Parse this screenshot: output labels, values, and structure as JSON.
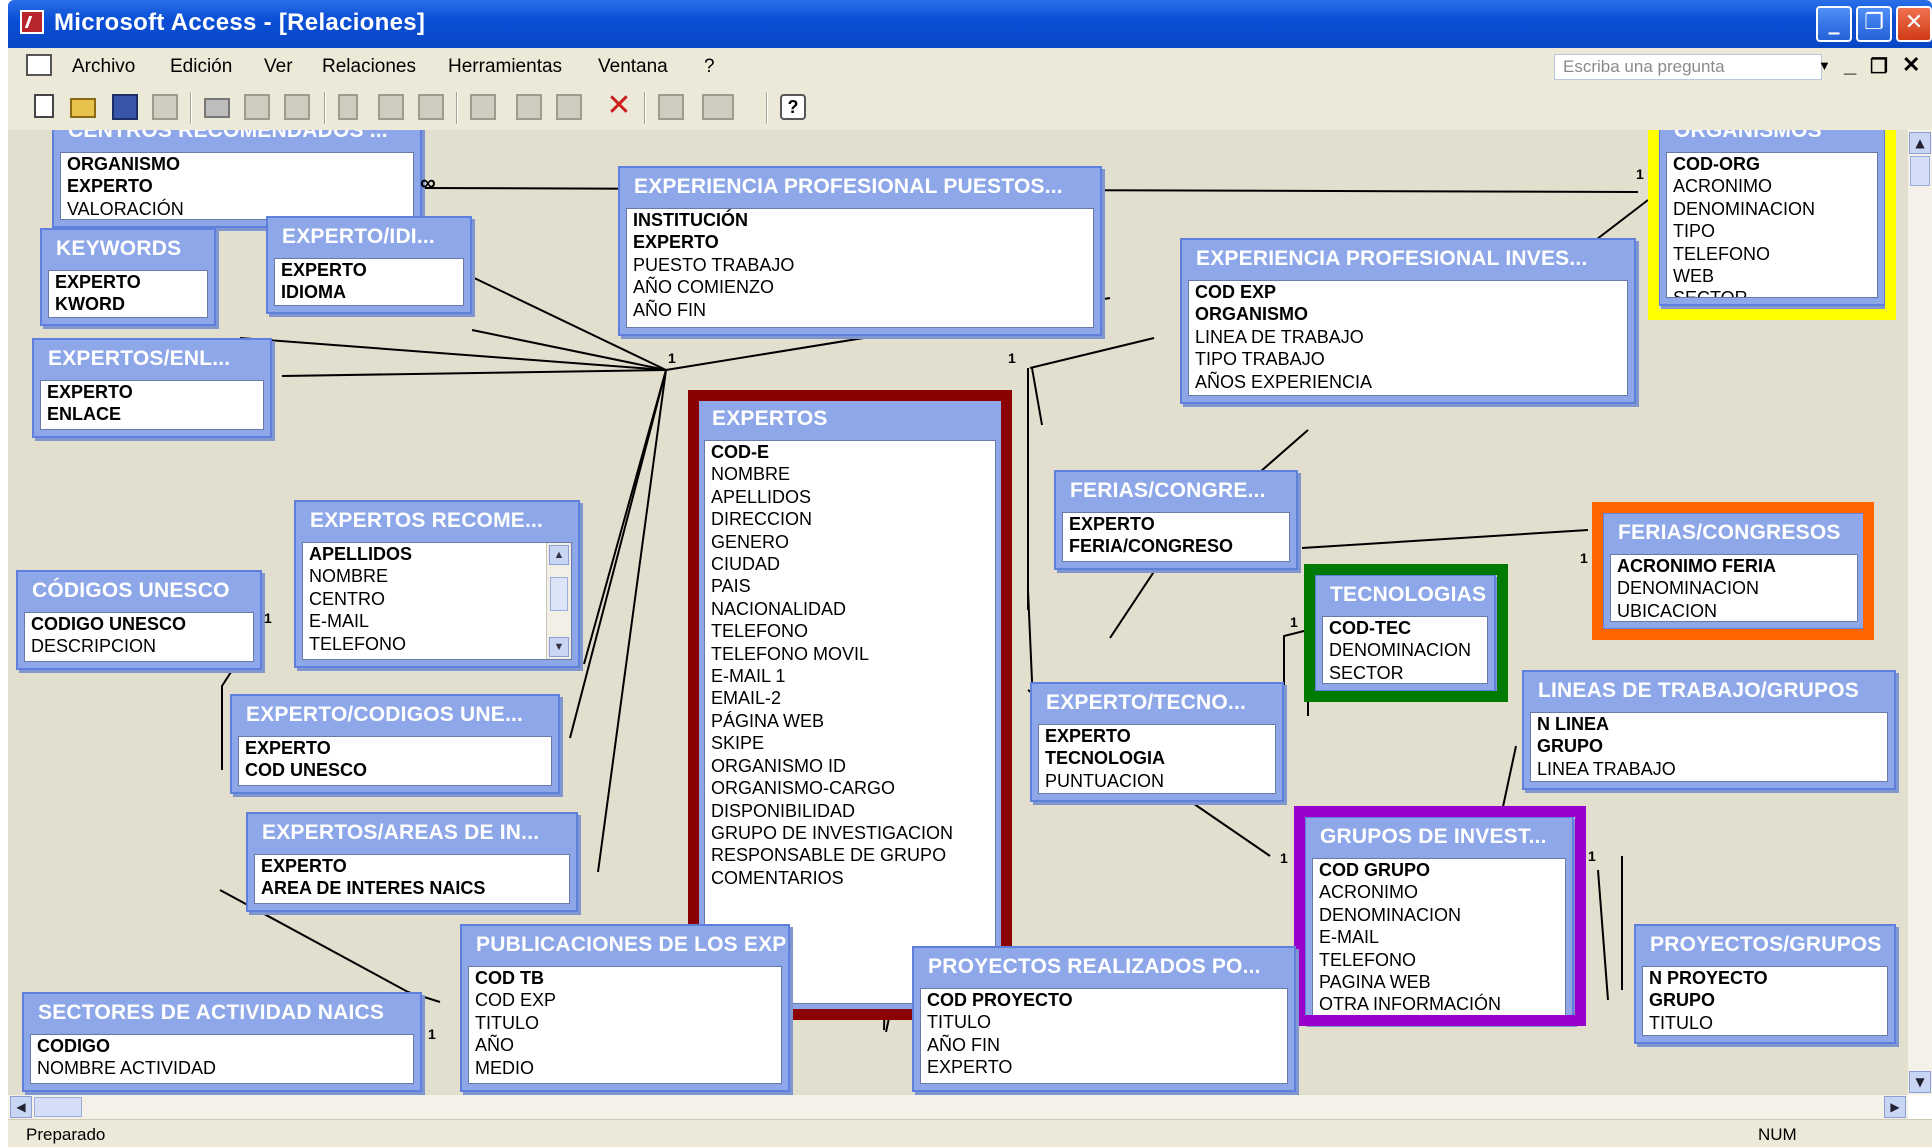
{
  "window": {
    "title": "Microsoft Access - [Relaciones]"
  },
  "menu": {
    "items": [
      "Archivo",
      "Edición",
      "Ver",
      "Relaciones",
      "Herramientas",
      "Ventana",
      "?"
    ],
    "ask_placeholder": "Escriba una pregunta"
  },
  "toolbar": {
    "icons": [
      "new-icon",
      "open-icon",
      "save-icon",
      "relationships-window-icon",
      "print-icon",
      "print-preview-icon",
      "spelling-icon",
      "cut-icon",
      "copy-icon",
      "paste-icon",
      "show-table-icon",
      "show-direct-icon",
      "show-all-icon",
      "delete-icon",
      "relationship-report-icon",
      "new-object-icon",
      "help-icon"
    ]
  },
  "tables": {
    "centros": {
      "title": "CENTROS RECOMENDADOS ...",
      "fields": [
        {
          "name": "ORGANISMO",
          "key": true
        },
        {
          "name": "EXPERTO",
          "key": true
        },
        {
          "name": "VALORACIÓN",
          "key": false
        }
      ]
    },
    "keywords": {
      "title": "KEYWORDS",
      "fields": [
        {
          "name": "EXPERTO",
          "key": true
        },
        {
          "name": "KWORD",
          "key": true
        }
      ]
    },
    "experto_idi": {
      "title": "EXPERTO/IDI...",
      "fields": [
        {
          "name": "EXPERTO",
          "key": true
        },
        {
          "name": "IDIOMA",
          "key": true
        }
      ]
    },
    "exp_puestos": {
      "title": "EXPERIENCIA PROFESIONAL PUESTOS...",
      "fields": [
        {
          "name": "INSTITUCIÓN",
          "key": true
        },
        {
          "name": "EXPERTO",
          "key": true
        },
        {
          "name": "PUESTO TRABAJO",
          "key": false
        },
        {
          "name": "AÑO COMIENZO",
          "key": false
        },
        {
          "name": "AÑO FIN",
          "key": false
        }
      ]
    },
    "organismos": {
      "title": "ORGANISMOS",
      "fields": [
        {
          "name": "COD-ORG",
          "key": true
        },
        {
          "name": "ACRONIMO",
          "key": false
        },
        {
          "name": "DENOMINACION",
          "key": false
        },
        {
          "name": "TIPO",
          "key": false
        },
        {
          "name": "TELEFONO",
          "key": false
        },
        {
          "name": "WEB",
          "key": false
        },
        {
          "name": "SECTOR",
          "key": false
        }
      ]
    },
    "exp_invest": {
      "title": "EXPERIENCIA PROFESIONAL INVES...",
      "fields": [
        {
          "name": "COD EXP",
          "key": true
        },
        {
          "name": "ORGANISMO",
          "key": true
        },
        {
          "name": "LINEA DE TRABAJO",
          "key": false
        },
        {
          "name": "TIPO TRABAJO",
          "key": false
        },
        {
          "name": "AÑOS EXPERIENCIA",
          "key": false
        }
      ]
    },
    "expertos_enl": {
      "title": "EXPERTOS/ENL...",
      "fields": [
        {
          "name": "EXPERTO",
          "key": true
        },
        {
          "name": "ENLACE",
          "key": true
        }
      ]
    },
    "expertos": {
      "title": "EXPERTOS",
      "fields": [
        {
          "name": "COD-E",
          "key": true
        },
        {
          "name": "NOMBRE",
          "key": false
        },
        {
          "name": "APELLIDOS",
          "key": false
        },
        {
          "name": "DIRECCION",
          "key": false
        },
        {
          "name": "GENERO",
          "key": false
        },
        {
          "name": "CIUDAD",
          "key": false
        },
        {
          "name": "PAIS",
          "key": false
        },
        {
          "name": "NACIONALIDAD",
          "key": false
        },
        {
          "name": "TELEFONO",
          "key": false
        },
        {
          "name": "TELEFONO MOVIL",
          "key": false
        },
        {
          "name": "E-MAIL 1",
          "key": false
        },
        {
          "name": "EMAIL-2",
          "key": false
        },
        {
          "name": "PÁGINA WEB",
          "key": false
        },
        {
          "name": "SKIPE",
          "key": false
        },
        {
          "name": "ORGANISMO ID",
          "key": false
        },
        {
          "name": "ORGANISMO-CARGO",
          "key": false
        },
        {
          "name": "DISPONIBILIDAD",
          "key": false
        },
        {
          "name": "GRUPO DE INVESTIGACION",
          "key": false
        },
        {
          "name": "RESPONSABLE DE GRUPO",
          "key": false
        },
        {
          "name": "COMENTARIOS",
          "key": false
        }
      ]
    },
    "expertos_recome": {
      "title": "EXPERTOS RECOME...",
      "fields": [
        {
          "name": "APELLIDOS",
          "key": true
        },
        {
          "name": "NOMBRE",
          "key": false
        },
        {
          "name": "CENTRO",
          "key": false
        },
        {
          "name": "E-MAIL",
          "key": false
        },
        {
          "name": "TELEFONO",
          "key": false
        }
      ]
    },
    "ferias_congre": {
      "title": "FERIAS/CONGRE...",
      "fields": [
        {
          "name": "EXPERTO",
          "key": true
        },
        {
          "name": "FERIA/CONGRESO",
          "key": true
        }
      ]
    },
    "ferias_congresos": {
      "title": "FERIAS/CONGRESOS",
      "fields": [
        {
          "name": "ACRONIMO FERIA",
          "key": true
        },
        {
          "name": "DENOMINACION",
          "key": false
        },
        {
          "name": "UBICACION",
          "key": false
        }
      ]
    },
    "codigos_unesco": {
      "title": "CÓDIGOS UNESCO",
      "fields": [
        {
          "name": "CODIGO UNESCO",
          "key": true
        },
        {
          "name": "DESCRIPCION",
          "key": false
        }
      ]
    },
    "tecnologias": {
      "title": "TECNOLOGIAS",
      "fields": [
        {
          "name": "COD-TEC",
          "key": true
        },
        {
          "name": "DENOMINACION",
          "key": false
        },
        {
          "name": "SECTOR",
          "key": false
        }
      ]
    },
    "experto_codigos": {
      "title": "EXPERTO/CODIGOS UNE...",
      "fields": [
        {
          "name": "EXPERTO",
          "key": true
        },
        {
          "name": "COD UNESCO",
          "key": true
        }
      ]
    },
    "experto_tecno": {
      "title": "EXPERTO/TECNO...",
      "fields": [
        {
          "name": "EXPERTO",
          "key": true
        },
        {
          "name": "TECNOLOGIA",
          "key": true
        },
        {
          "name": "PUNTUACION",
          "key": false
        }
      ]
    },
    "lineas_trabajo": {
      "title": "LINEAS DE TRABAJO/GRUPOS",
      "fields": [
        {
          "name": "N LINEA",
          "key": true
        },
        {
          "name": "GRUPO",
          "key": true
        },
        {
          "name": "LINEA TRABAJO",
          "key": false
        }
      ]
    },
    "expertos_areas": {
      "title": "EXPERTOS/AREAS DE IN...",
      "fields": [
        {
          "name": "EXPERTO",
          "key": true
        },
        {
          "name": "AREA DE INTERES NAICS",
          "key": true
        }
      ]
    },
    "grupos_invest": {
      "title": "GRUPOS DE INVEST...",
      "fields": [
        {
          "name": "COD GRUPO",
          "key": true
        },
        {
          "name": "ACRONIMO",
          "key": false
        },
        {
          "name": "DENOMINACION",
          "key": false
        },
        {
          "name": "E-MAIL",
          "key": false
        },
        {
          "name": "TELEFONO",
          "key": false
        },
        {
          "name": "PAGINA WEB",
          "key": false
        },
        {
          "name": "OTRA INFORMACIÓN",
          "key": false
        }
      ]
    },
    "publicaciones": {
      "title": "PUBLICACIONES DE LOS EXPE...",
      "fields": [
        {
          "name": "COD TB",
          "key": true
        },
        {
          "name": "COD EXP",
          "key": false
        },
        {
          "name": "TITULO",
          "key": false
        },
        {
          "name": "AÑO",
          "key": false
        },
        {
          "name": "MEDIO",
          "key": false
        }
      ]
    },
    "proyectos_realizados": {
      "title": "PROYECTOS REALIZADOS PO...",
      "fields": [
        {
          "name": "COD PROYECTO",
          "key": true
        },
        {
          "name": "TITULO",
          "key": false
        },
        {
          "name": "AÑO FIN",
          "key": false
        },
        {
          "name": "EXPERTO",
          "key": false
        }
      ]
    },
    "proyectos_grupos": {
      "title": "PROYECTOS/GRUPOS",
      "fields": [
        {
          "name": "N PROYECTO",
          "key": true
        },
        {
          "name": "GRUPO",
          "key": true
        },
        {
          "name": "TITULO",
          "key": false
        }
      ]
    },
    "sectores_naics": {
      "title": "SECTORES DE ACTIVIDAD NAICS",
      "fields": [
        {
          "name": "CODIGO",
          "key": true
        },
        {
          "name": "NOMBRE ACTIVIDAD",
          "key": false
        }
      ]
    }
  },
  "highlights": {
    "expertos": "#8b0000",
    "organismos": "#ffff00",
    "ferias_congresos": "#ff6600",
    "tecnologias": "#007a00",
    "grupos_invest": "#9900cc"
  },
  "cardinality": {
    "one": "1",
    "many": "∞"
  },
  "statusbar": {
    "text": "Preparado",
    "num": "NUM"
  }
}
